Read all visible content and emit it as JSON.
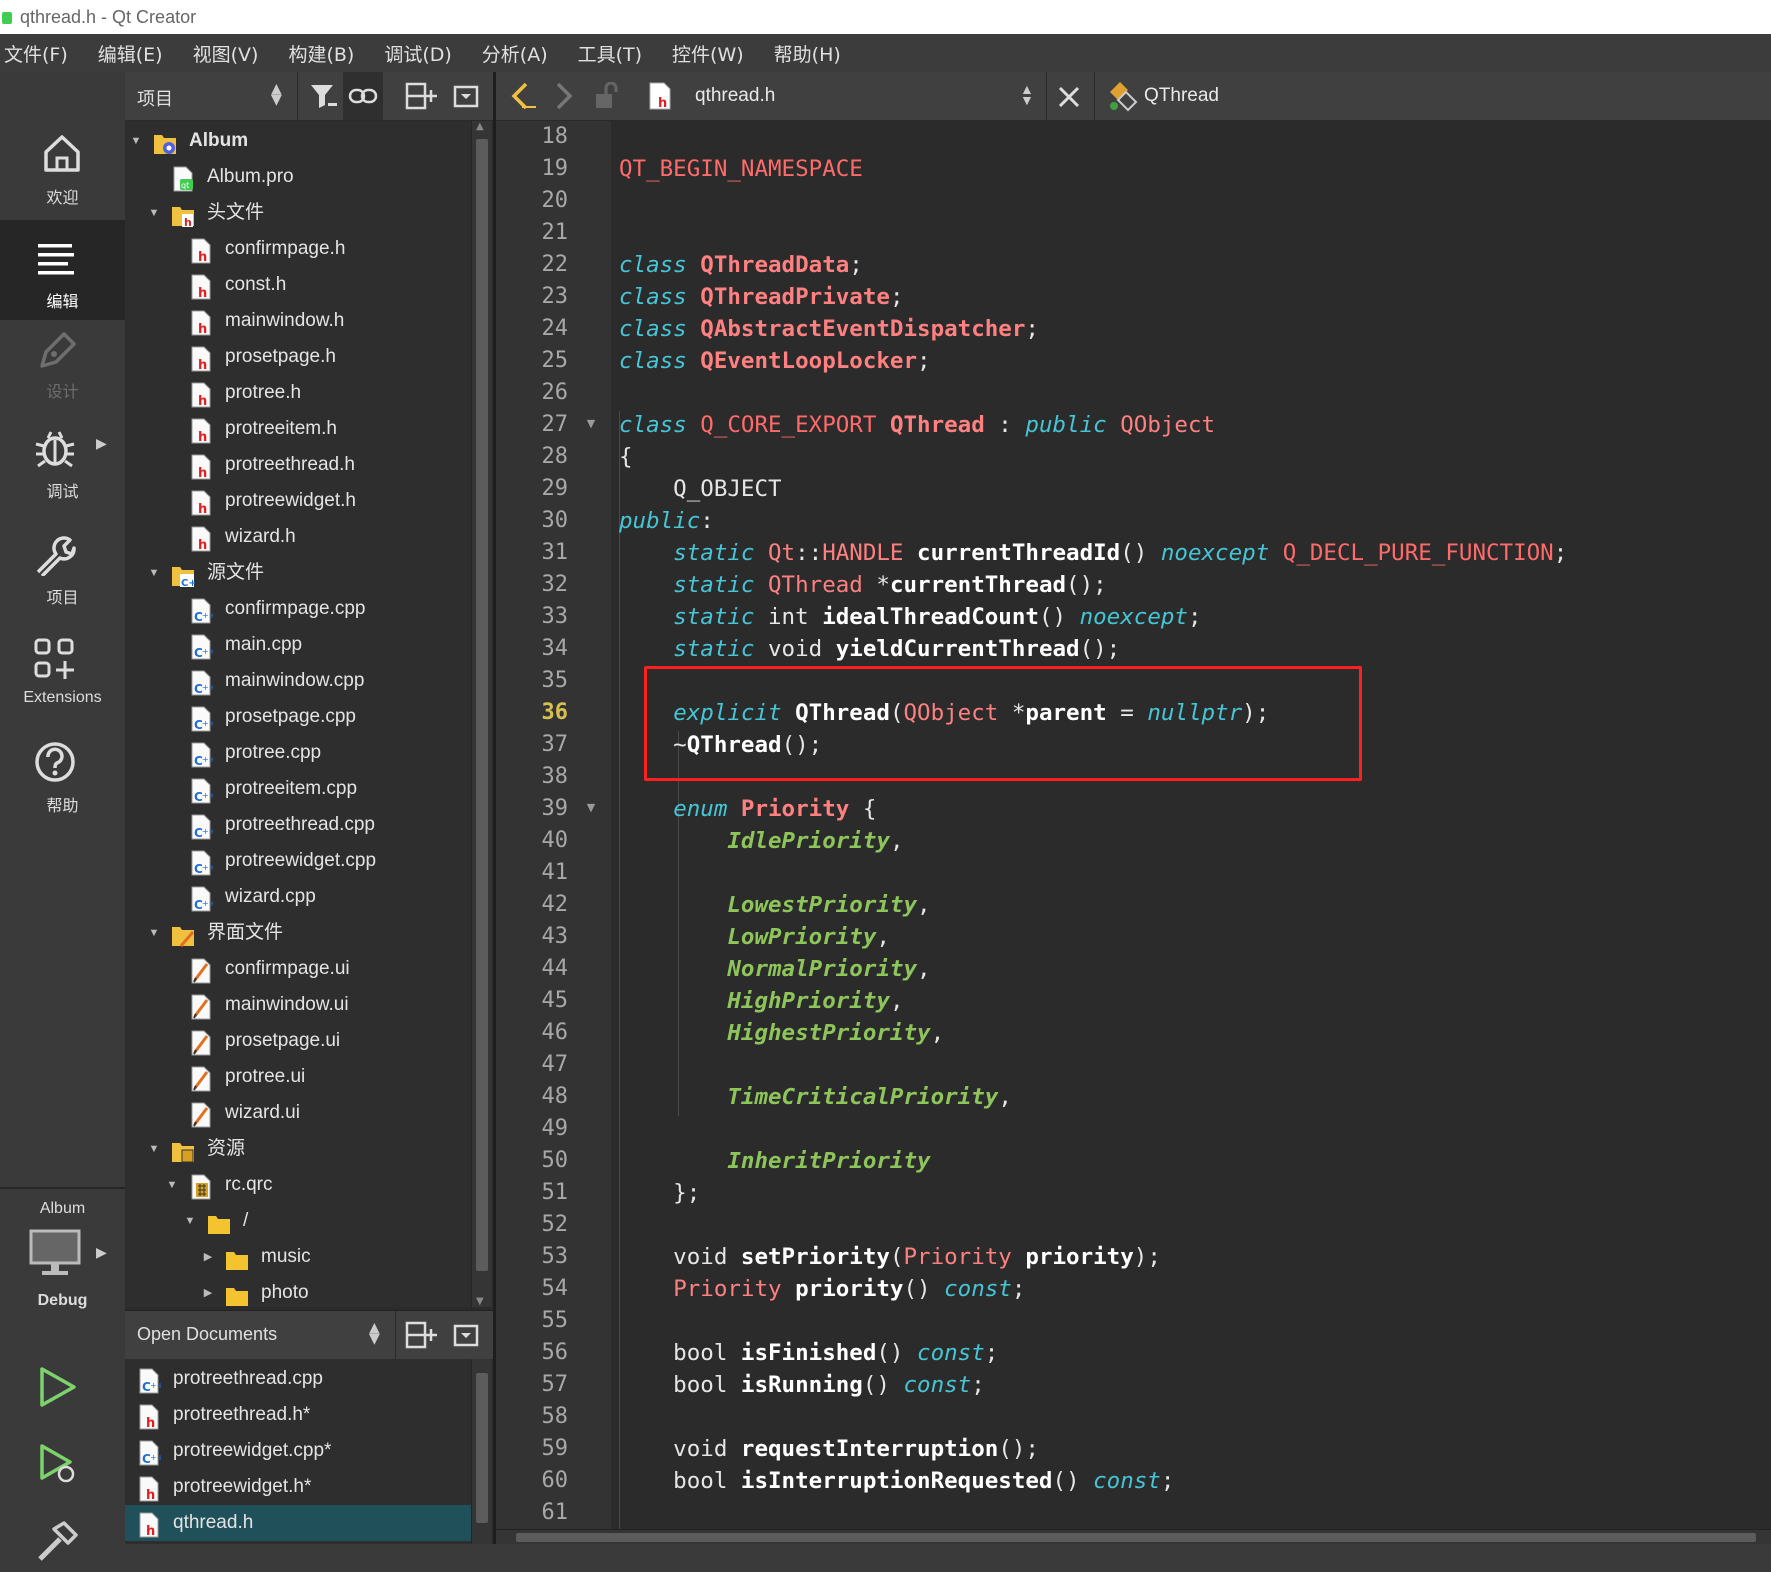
{
  "window": {
    "title": "qthread.h - Qt Creator"
  },
  "menu": [
    "文件(F)",
    "编辑(E)",
    "视图(V)",
    "构建(B)",
    "调试(D)",
    "分析(A)",
    "工具(T)",
    "控件(W)",
    "帮助(H)"
  ],
  "modes": {
    "welcome": "欢迎",
    "edit": "编辑",
    "design": "设计",
    "debug": "调试",
    "projects": "项目",
    "extensions": "Extensions",
    "help": "帮助",
    "target_project": "Album",
    "target_config": "Debug"
  },
  "project_panel": {
    "selector": "项目",
    "tree": [
      {
        "label": "Album",
        "level": 0,
        "icon": "project-icon",
        "expanded": true,
        "bold": true
      },
      {
        "label": "Album.pro",
        "level": 1,
        "icon": "pro-file-icon"
      },
      {
        "label": "头文件",
        "level": 1,
        "icon": "header-folder-icon",
        "expanded": true
      },
      {
        "label": "confirmpage.h",
        "level": 2,
        "icon": "header-file-icon"
      },
      {
        "label": "const.h",
        "level": 2,
        "icon": "header-file-icon"
      },
      {
        "label": "mainwindow.h",
        "level": 2,
        "icon": "header-file-icon"
      },
      {
        "label": "prosetpage.h",
        "level": 2,
        "icon": "header-file-icon"
      },
      {
        "label": "protree.h",
        "level": 2,
        "icon": "header-file-icon"
      },
      {
        "label": "protreeitem.h",
        "level": 2,
        "icon": "header-file-icon"
      },
      {
        "label": "protreethread.h",
        "level": 2,
        "icon": "header-file-icon"
      },
      {
        "label": "protreewidget.h",
        "level": 2,
        "icon": "header-file-icon"
      },
      {
        "label": "wizard.h",
        "level": 2,
        "icon": "header-file-icon"
      },
      {
        "label": "源文件",
        "level": 1,
        "icon": "source-folder-icon",
        "expanded": true
      },
      {
        "label": "confirmpage.cpp",
        "level": 2,
        "icon": "cpp-file-icon"
      },
      {
        "label": "main.cpp",
        "level": 2,
        "icon": "cpp-file-icon"
      },
      {
        "label": "mainwindow.cpp",
        "level": 2,
        "icon": "cpp-file-icon"
      },
      {
        "label": "prosetpage.cpp",
        "level": 2,
        "icon": "cpp-file-icon"
      },
      {
        "label": "protree.cpp",
        "level": 2,
        "icon": "cpp-file-icon"
      },
      {
        "label": "protreeitem.cpp",
        "level": 2,
        "icon": "cpp-file-icon"
      },
      {
        "label": "protreethread.cpp",
        "level": 2,
        "icon": "cpp-file-icon"
      },
      {
        "label": "protreewidget.cpp",
        "level": 2,
        "icon": "cpp-file-icon"
      },
      {
        "label": "wizard.cpp",
        "level": 2,
        "icon": "cpp-file-icon"
      },
      {
        "label": "界面文件",
        "level": 1,
        "icon": "forms-folder-icon",
        "expanded": true
      },
      {
        "label": "confirmpage.ui",
        "level": 2,
        "icon": "ui-file-icon"
      },
      {
        "label": "mainwindow.ui",
        "level": 2,
        "icon": "ui-file-icon"
      },
      {
        "label": "prosetpage.ui",
        "level": 2,
        "icon": "ui-file-icon"
      },
      {
        "label": "protree.ui",
        "level": 2,
        "icon": "ui-file-icon"
      },
      {
        "label": "wizard.ui",
        "level": 2,
        "icon": "ui-file-icon"
      },
      {
        "label": "资源",
        "level": 1,
        "icon": "resources-folder-icon",
        "expanded": true
      },
      {
        "label": "rc.qrc",
        "level": 2,
        "icon": "qrc-file-icon",
        "expanded": true
      },
      {
        "label": "/",
        "level": 3,
        "icon": "folder-icon",
        "expanded": true
      },
      {
        "label": "music",
        "level": 4,
        "icon": "folder-icon",
        "expanded": false
      },
      {
        "label": "photo",
        "level": 4,
        "icon": "folder-icon",
        "expanded": false
      }
    ]
  },
  "open_documents": {
    "title": "Open Documents",
    "items": [
      {
        "label": "protreethread.cpp",
        "icon": "cpp-file-icon"
      },
      {
        "label": "protreethread.h*",
        "icon": "header-file-icon"
      },
      {
        "label": "protreewidget.cpp*",
        "icon": "cpp-file-icon"
      },
      {
        "label": "protreewidget.h*",
        "icon": "header-file-icon"
      },
      {
        "label": "qthread.h",
        "icon": "header-file-icon",
        "selected": true
      }
    ]
  },
  "editor": {
    "file_name": "qthread.h",
    "symbol": "QThread",
    "current_line": 36,
    "lines": [
      {
        "n": 18,
        "t": []
      },
      {
        "n": 19,
        "t": [
          [
            "mac",
            "QT_BEGIN_NAMESPACE"
          ]
        ]
      },
      {
        "n": 20,
        "t": []
      },
      {
        "n": 21,
        "t": []
      },
      {
        "n": 22,
        "t": [
          [
            "kw",
            "class"
          ],
          [
            "pl",
            " "
          ],
          [
            "tyb",
            "QThreadData"
          ],
          [
            "pl",
            ";"
          ]
        ]
      },
      {
        "n": 23,
        "t": [
          [
            "kw",
            "class"
          ],
          [
            "pl",
            " "
          ],
          [
            "tyb",
            "QThreadPrivate"
          ],
          [
            "pl",
            ";"
          ]
        ]
      },
      {
        "n": 24,
        "t": [
          [
            "kw",
            "class"
          ],
          [
            "pl",
            " "
          ],
          [
            "tyb",
            "QAbstractEventDispatcher"
          ],
          [
            "pl",
            ";"
          ]
        ]
      },
      {
        "n": 25,
        "t": [
          [
            "kw",
            "class"
          ],
          [
            "pl",
            " "
          ],
          [
            "tyb",
            "QEventLoopLocker"
          ],
          [
            "pl",
            ";"
          ]
        ]
      },
      {
        "n": 26,
        "t": []
      },
      {
        "n": 27,
        "fold": true,
        "t": [
          [
            "kw",
            "class"
          ],
          [
            "pl",
            " "
          ],
          [
            "mac",
            "Q_CORE_EXPORT"
          ],
          [
            "pl",
            " "
          ],
          [
            "tyb",
            "QThread"
          ],
          [
            "pl",
            " : "
          ],
          [
            "kw",
            "public"
          ],
          [
            "pl",
            " "
          ],
          [
            "ty",
            "QObject"
          ]
        ]
      },
      {
        "n": 28,
        "t": [
          [
            "pl",
            "{"
          ]
        ]
      },
      {
        "n": 29,
        "t": [
          [
            "pl",
            "    Q_OBJECT"
          ]
        ]
      },
      {
        "n": 30,
        "t": [
          [
            "kw",
            "public"
          ],
          [
            "pl",
            ":"
          ]
        ]
      },
      {
        "n": 31,
        "t": [
          [
            "pl",
            "    "
          ],
          [
            "kw",
            "static"
          ],
          [
            "pl",
            " "
          ],
          [
            "ty",
            "Qt"
          ],
          [
            "pl",
            "::"
          ],
          [
            "ty",
            "HANDLE"
          ],
          [
            "pl",
            " "
          ],
          [
            "fn",
            "currentThreadId"
          ],
          [
            "pl",
            "() "
          ],
          [
            "kw",
            "noexcept"
          ],
          [
            "pl",
            " "
          ],
          [
            "mac",
            "Q_DECL_PURE_FUNCTION"
          ],
          [
            "pl",
            ";"
          ]
        ]
      },
      {
        "n": 32,
        "t": [
          [
            "pl",
            "    "
          ],
          [
            "kw",
            "static"
          ],
          [
            "pl",
            " "
          ],
          [
            "ty",
            "QThread"
          ],
          [
            "pl",
            " *"
          ],
          [
            "fn",
            "currentThread"
          ],
          [
            "pl",
            "();"
          ]
        ]
      },
      {
        "n": 33,
        "t": [
          [
            "pl",
            "    "
          ],
          [
            "kw",
            "static"
          ],
          [
            "pl",
            " int "
          ],
          [
            "fn",
            "idealThreadCount"
          ],
          [
            "pl",
            "() "
          ],
          [
            "kw",
            "noexcept"
          ],
          [
            "pl",
            ";"
          ]
        ]
      },
      {
        "n": 34,
        "t": [
          [
            "pl",
            "    "
          ],
          [
            "kw",
            "static"
          ],
          [
            "pl",
            " void "
          ],
          [
            "fn",
            "yieldCurrentThread"
          ],
          [
            "pl",
            "();"
          ]
        ]
      },
      {
        "n": 35,
        "t": []
      },
      {
        "n": 36,
        "t": [
          [
            "pl",
            "    "
          ],
          [
            "kw",
            "explicit"
          ],
          [
            "pl",
            " "
          ],
          [
            "fn",
            "QThread"
          ],
          [
            "pl",
            "("
          ],
          [
            "ty",
            "QObject"
          ],
          [
            "pl",
            " *"
          ],
          [
            "fn",
            "parent"
          ],
          [
            "pl",
            " = "
          ],
          [
            "kw",
            "nullptr"
          ],
          [
            "pl",
            ");"
          ]
        ]
      },
      {
        "n": 37,
        "t": [
          [
            "pl",
            "    ~"
          ],
          [
            "fn",
            "QThread"
          ],
          [
            "pl",
            "();"
          ]
        ]
      },
      {
        "n": 38,
        "t": []
      },
      {
        "n": 39,
        "fold": true,
        "t": [
          [
            "pl",
            "    "
          ],
          [
            "kw",
            "enum"
          ],
          [
            "pl",
            " "
          ],
          [
            "tyb",
            "Priority"
          ],
          [
            "pl",
            " {"
          ]
        ]
      },
      {
        "n": 40,
        "t": [
          [
            "pl",
            "        "
          ],
          [
            "en",
            "IdlePriority"
          ],
          [
            "pl",
            ","
          ]
        ]
      },
      {
        "n": 41,
        "t": []
      },
      {
        "n": 42,
        "t": [
          [
            "pl",
            "        "
          ],
          [
            "en",
            "LowestPriority"
          ],
          [
            "pl",
            ","
          ]
        ]
      },
      {
        "n": 43,
        "t": [
          [
            "pl",
            "        "
          ],
          [
            "en",
            "LowPriority"
          ],
          [
            "pl",
            ","
          ]
        ]
      },
      {
        "n": 44,
        "t": [
          [
            "pl",
            "        "
          ],
          [
            "en",
            "NormalPriority"
          ],
          [
            "pl",
            ","
          ]
        ]
      },
      {
        "n": 45,
        "t": [
          [
            "pl",
            "        "
          ],
          [
            "en",
            "HighPriority"
          ],
          [
            "pl",
            ","
          ]
        ]
      },
      {
        "n": 46,
        "t": [
          [
            "pl",
            "        "
          ],
          [
            "en",
            "HighestPriority"
          ],
          [
            "pl",
            ","
          ]
        ]
      },
      {
        "n": 47,
        "t": []
      },
      {
        "n": 48,
        "t": [
          [
            "pl",
            "        "
          ],
          [
            "en",
            "TimeCriticalPriority"
          ],
          [
            "pl",
            ","
          ]
        ]
      },
      {
        "n": 49,
        "t": []
      },
      {
        "n": 50,
        "t": [
          [
            "pl",
            "        "
          ],
          [
            "en",
            "InheritPriority"
          ]
        ]
      },
      {
        "n": 51,
        "t": [
          [
            "pl",
            "    };"
          ]
        ]
      },
      {
        "n": 52,
        "t": []
      },
      {
        "n": 53,
        "t": [
          [
            "pl",
            "    void "
          ],
          [
            "fn",
            "setPriority"
          ],
          [
            "pl",
            "("
          ],
          [
            "ty",
            "Priority"
          ],
          [
            "pl",
            " "
          ],
          [
            "fn",
            "priority"
          ],
          [
            "pl",
            ");"
          ]
        ]
      },
      {
        "n": 54,
        "t": [
          [
            "pl",
            "    "
          ],
          [
            "ty",
            "Priority"
          ],
          [
            "pl",
            " "
          ],
          [
            "fn",
            "priority"
          ],
          [
            "pl",
            "() "
          ],
          [
            "kw",
            "const"
          ],
          [
            "pl",
            ";"
          ]
        ]
      },
      {
        "n": 55,
        "t": []
      },
      {
        "n": 56,
        "t": [
          [
            "pl",
            "    bool "
          ],
          [
            "fn",
            "isFinished"
          ],
          [
            "pl",
            "() "
          ],
          [
            "kw",
            "const"
          ],
          [
            "pl",
            ";"
          ]
        ]
      },
      {
        "n": 57,
        "t": [
          [
            "pl",
            "    bool "
          ],
          [
            "fn",
            "isRunning"
          ],
          [
            "pl",
            "() "
          ],
          [
            "kw",
            "const"
          ],
          [
            "pl",
            ";"
          ]
        ]
      },
      {
        "n": 58,
        "t": []
      },
      {
        "n": 59,
        "t": [
          [
            "pl",
            "    void "
          ],
          [
            "fn",
            "requestInterruption"
          ],
          [
            "pl",
            "();"
          ]
        ]
      },
      {
        "n": 60,
        "t": [
          [
            "pl",
            "    bool "
          ],
          [
            "fn",
            "isInterruptionRequested"
          ],
          [
            "pl",
            "() "
          ],
          [
            "kw",
            "const"
          ],
          [
            "pl",
            ";"
          ]
        ]
      },
      {
        "n": 61,
        "t": []
      }
    ]
  },
  "colors": {
    "keyword": "#45c6d6",
    "type": "#ff8080",
    "enum_value": "#8ec55b",
    "function": "#ffffff",
    "highlight_box": "#ff2020",
    "selection": "#20505a"
  }
}
